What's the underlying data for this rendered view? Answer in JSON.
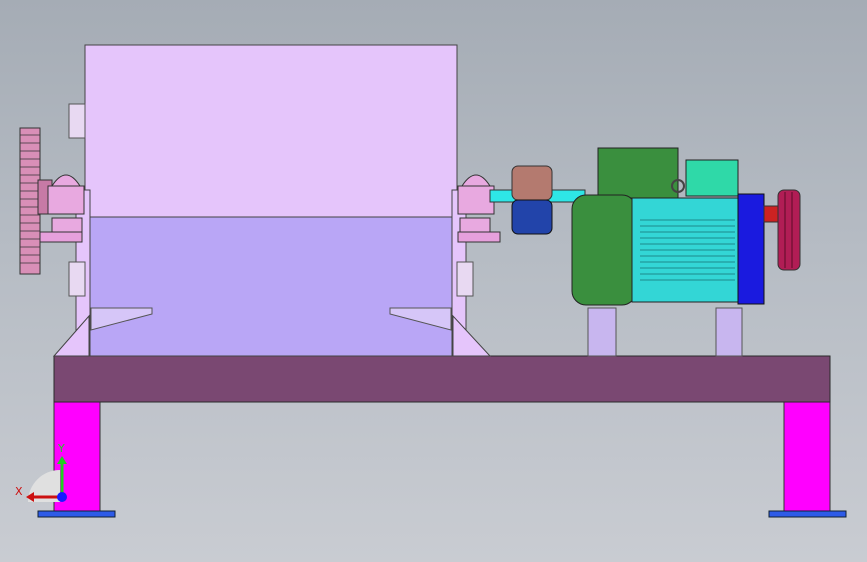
{
  "viewport": {
    "background_top": "#a5acb5",
    "background_bottom": "#c9ccd2"
  },
  "axis_triad": {
    "x_label": "X",
    "y_label": "Y",
    "x_color": "#cc1111",
    "y_color": "#22cc22",
    "z_color": "#1a1aff"
  },
  "colors": {
    "hopper_body": "#e5c5fb",
    "hopper_lower": "#b9a6f6",
    "base_frame": "#7a4872",
    "legs": "#ff00ff",
    "feet": "#2d5be8",
    "gear": "#d98fb7",
    "bearing": "#e8a9e0",
    "coupling": "#b47a6f",
    "coupling_blue": "#2244aa",
    "shaft": "#2ee6e6",
    "motor_green": "#3a8f3e",
    "motor_fins": "#33d6d6",
    "motor_flange": "#1a1adf",
    "pulley": "#b11d55"
  }
}
